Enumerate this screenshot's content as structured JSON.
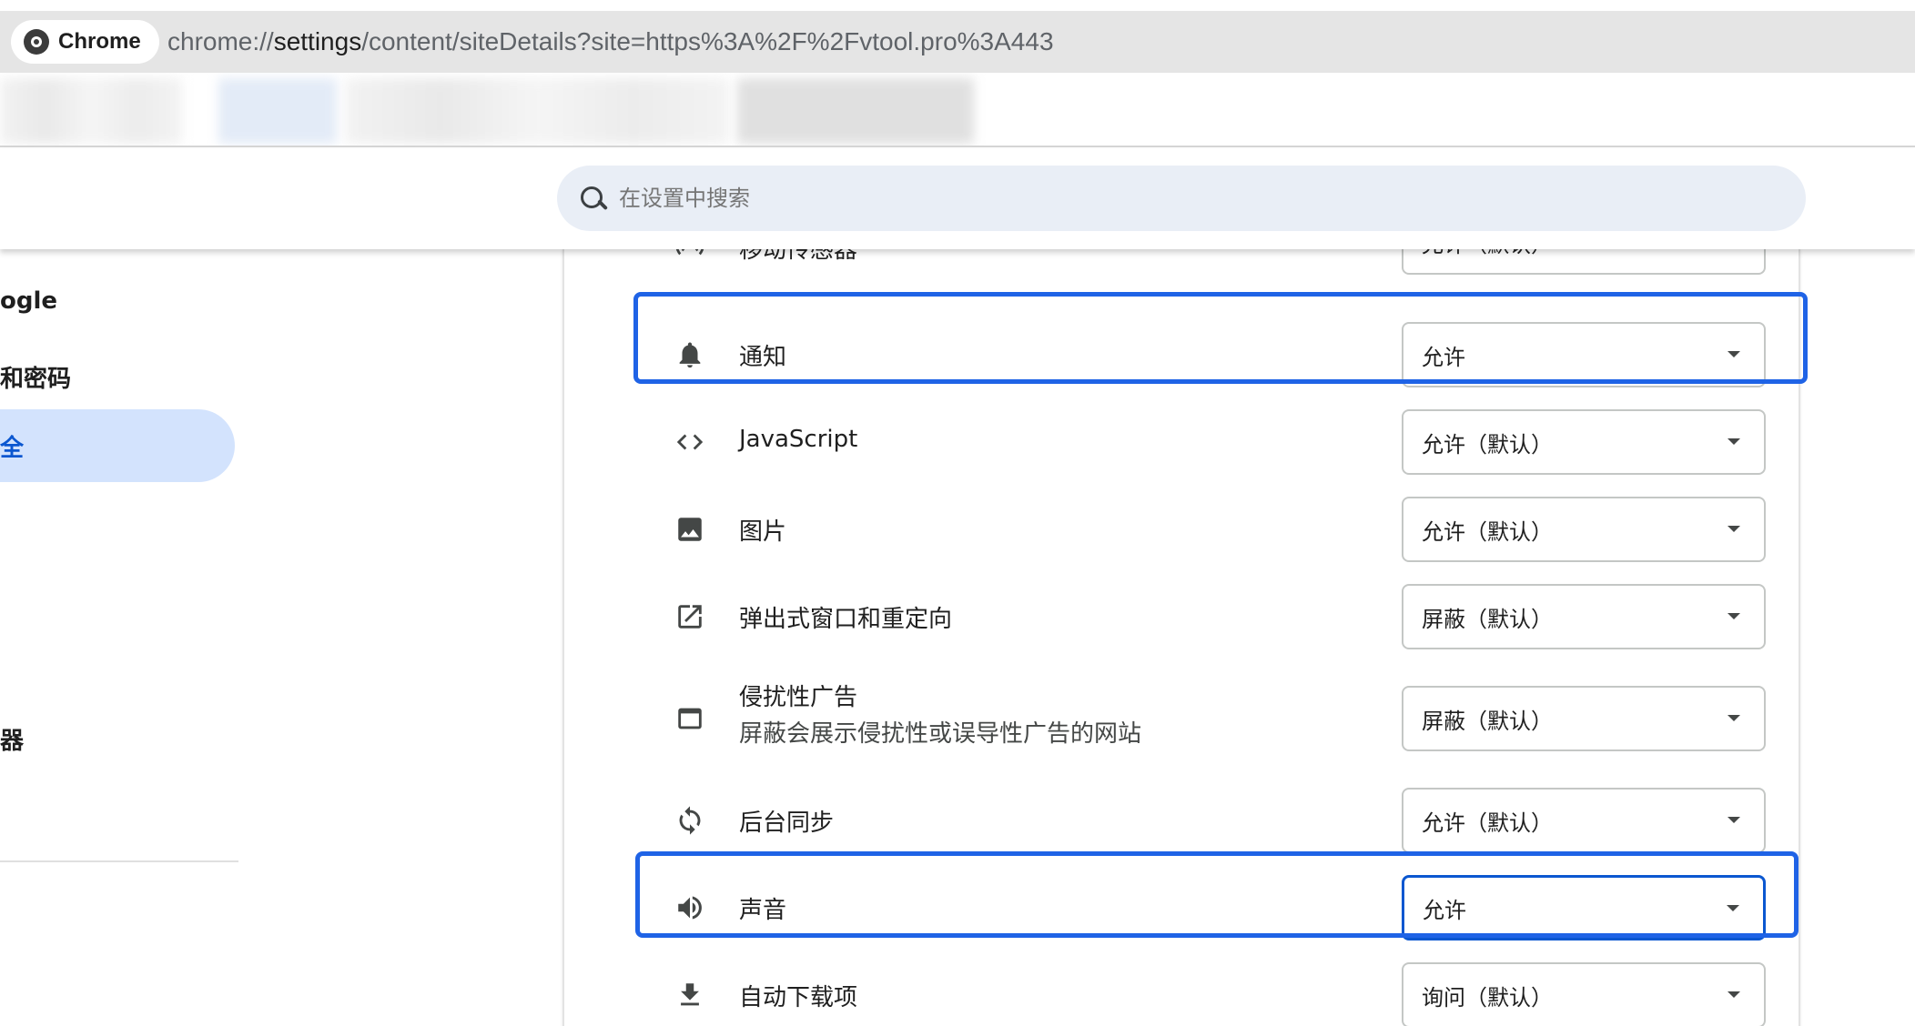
{
  "browser": {
    "chip_label": "Chrome",
    "url_scheme": "chrome://",
    "url_host": "settings",
    "url_path": "/content/siteDetails?site=https%3A%2F%2Fvtool.pro%3A443"
  },
  "search": {
    "placeholder": "在设置中搜索"
  },
  "sidebar": {
    "items": [
      {
        "label": "ogle"
      },
      {
        "label": "和密码"
      },
      {
        "label": "全",
        "active": true
      },
      {
        "label": "器"
      }
    ]
  },
  "permissions": [
    {
      "title": "移动传感器",
      "value": "允许（默认）",
      "icon": "motion-sensor-icon"
    },
    {
      "title": "通知",
      "value": "允许",
      "icon": "bell-icon",
      "highlighted": true
    },
    {
      "title": "JavaScript",
      "value": "允许（默认）",
      "icon": "code-icon"
    },
    {
      "title": "图片",
      "value": "允许（默认）",
      "icon": "image-icon"
    },
    {
      "title": "弹出式窗口和重定向",
      "value": "屏蔽（默认）",
      "icon": "open-in-new-icon"
    },
    {
      "title": "侵扰性广告",
      "subtitle": "屏蔽会展示侵扰性或误导性广告的网站",
      "value": "屏蔽（默认）",
      "icon": "window-icon"
    },
    {
      "title": "后台同步",
      "value": "允许（默认）",
      "icon": "sync-icon"
    },
    {
      "title": "声音",
      "value": "允许",
      "icon": "volume-icon",
      "highlighted": true,
      "focused": true
    },
    {
      "title": "自动下载项",
      "value": "询问（默认）",
      "icon": "download-icon"
    }
  ],
  "colors": {
    "highlight": "#1f63e6",
    "focus": "#0b57d0",
    "active_nav_bg": "#d3e3fd"
  }
}
